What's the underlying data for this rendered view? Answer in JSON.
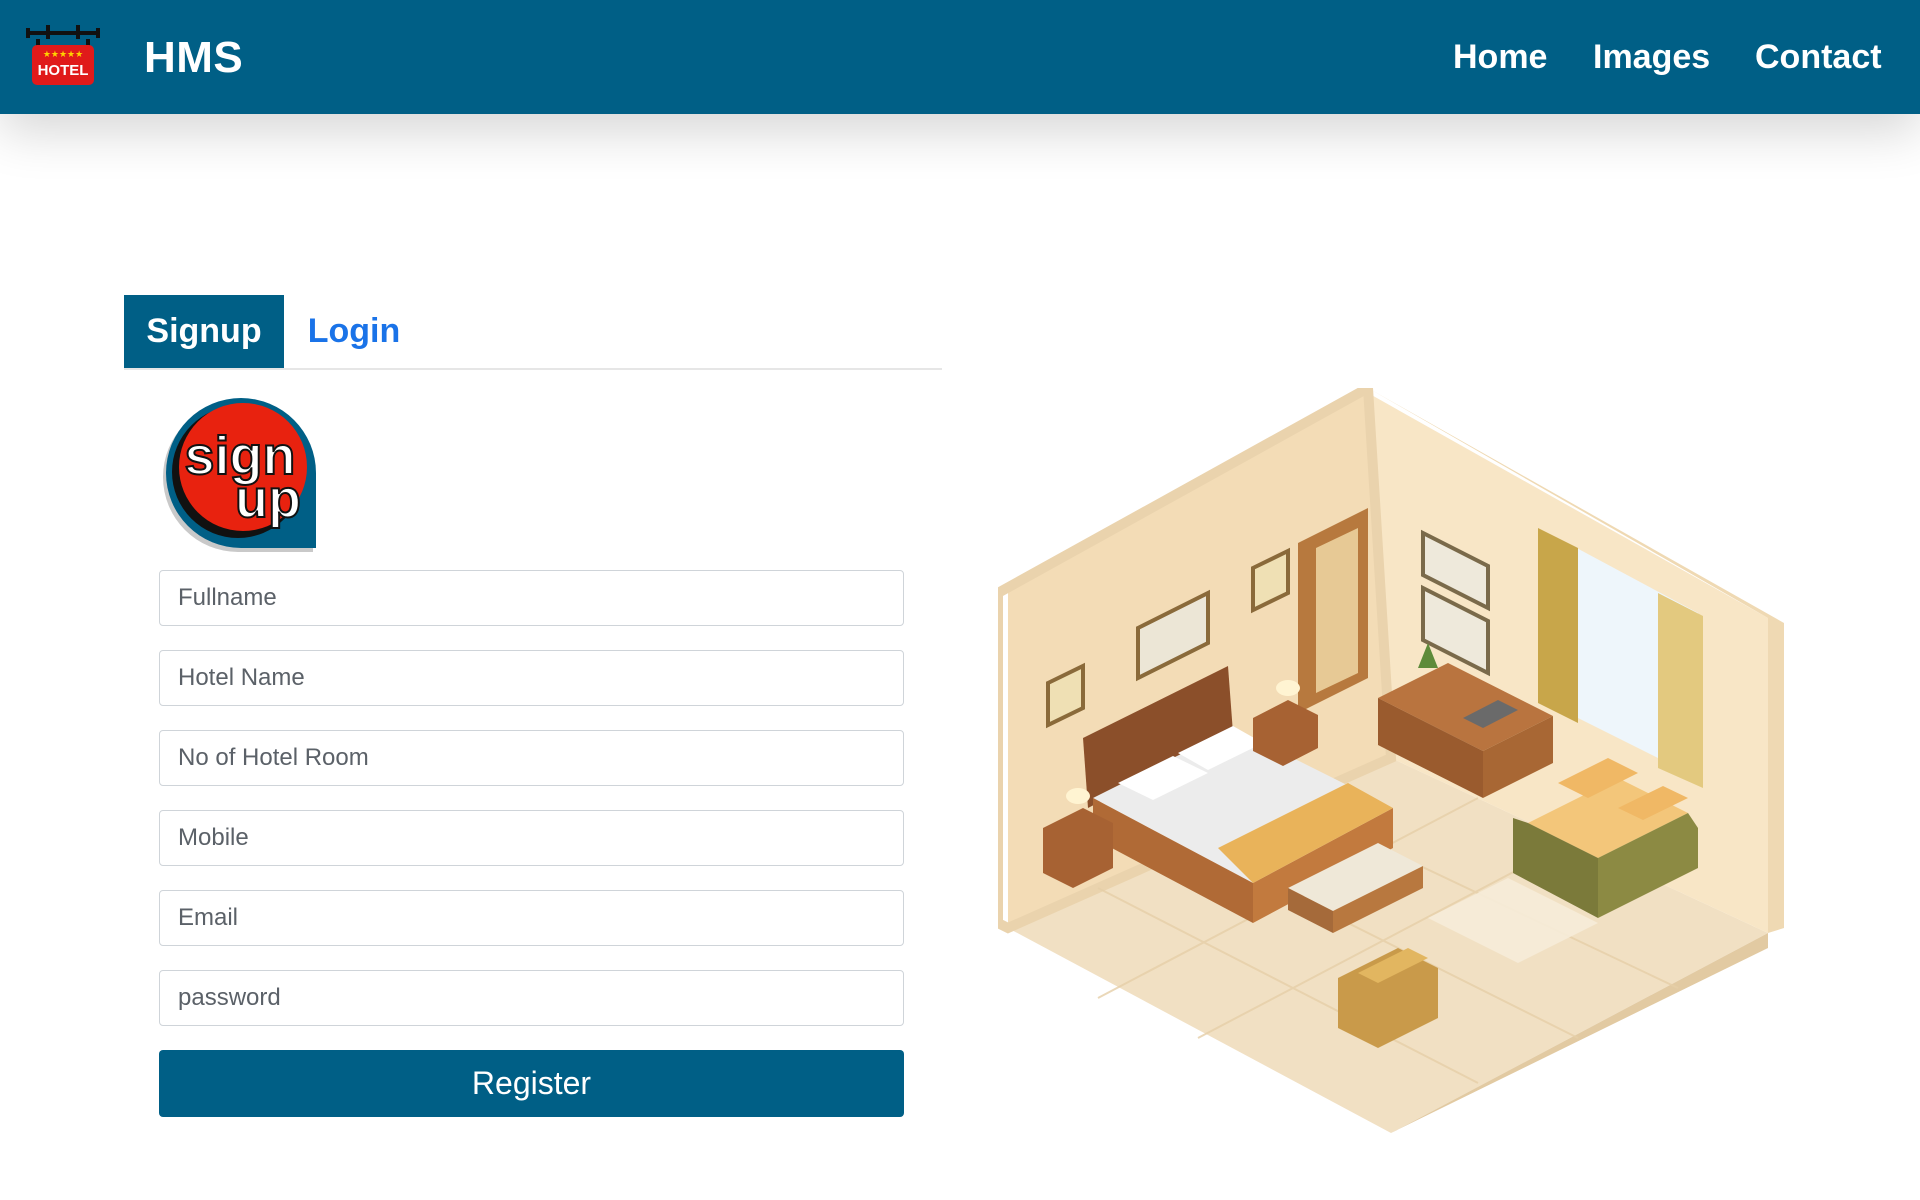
{
  "header": {
    "logo_text": "HOTEL",
    "brand": "HMS",
    "nav": [
      "Home",
      "Images",
      "Contact"
    ]
  },
  "tabs": {
    "signup": "Signup",
    "login": "Login"
  },
  "signup_logo_text": [
    "sign",
    "up"
  ],
  "form": {
    "fullname_placeholder": "Fullname",
    "hotel_name_placeholder": "Hotel Name",
    "rooms_placeholder": "No of Hotel Room",
    "mobile_placeholder": "Mobile",
    "email_placeholder": "Email",
    "password_placeholder": "password",
    "register_label": "Register"
  },
  "colors": {
    "primary": "#005f86",
    "link": "#1a73e8",
    "logo_red": "#e01a1a"
  }
}
